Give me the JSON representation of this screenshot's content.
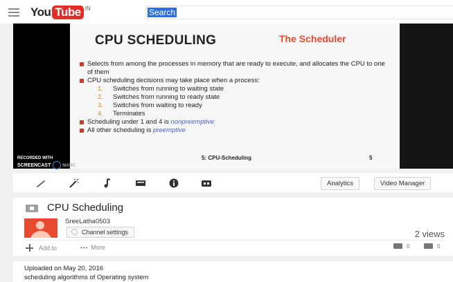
{
  "header": {
    "logo_you": "You",
    "logo_tube": "Tube",
    "logo_region": "IN",
    "search_value": "Search"
  },
  "video": {
    "slide": {
      "title": "CPU SCHEDULING",
      "subtitle": "The Scheduler",
      "bullet1": "Selects from among the processes in memory that are ready to execute, and allocates the CPU to one of them",
      "bullet2": "CPU scheduling decisions may take place when a process:",
      "items": [
        {
          "num": "1.",
          "text": "Switches from running to waiting state"
        },
        {
          "num": "2.",
          "text": "Switches from running to ready state"
        },
        {
          "num": "3.",
          "text": "Switches from waiting to ready"
        },
        {
          "num": "4.",
          "text": "Terminates"
        }
      ],
      "bullet3_prefix": "Scheduling under 1 and 4 is ",
      "bullet3_italic": "nonpreemptive",
      "bullet4_prefix": "All other scheduling is ",
      "bullet4_italic": "preemptive",
      "footer": "5: CPU-Scheduling",
      "page": "5"
    },
    "watermark": {
      "line1": "RECORDED WITH",
      "line2": "SCREENCAST",
      "line3": "MATIC"
    }
  },
  "controls": {
    "icons": [
      "pen-icon",
      "magic-wand-icon",
      "music-note-icon",
      "annotation-icon",
      "info-icon",
      "captions-icon"
    ],
    "analytics_label": "Analytics",
    "video_manager_label": "Video Manager"
  },
  "info": {
    "title": "CPU Scheduling",
    "channel_name": "SreeLatha0503",
    "channel_settings_label": "Channel settings",
    "views": "2 views",
    "add_to_label": "Add to",
    "more_label": "More",
    "likes": "0",
    "dislikes": "0"
  },
  "description": {
    "uploaded": "Uploaded on May 20, 2016",
    "text": "scheduling algorithms of Operating system"
  },
  "colors": {
    "brand_red": "#e52d27",
    "slide_accent": "#e8472a",
    "search_selection": "#2f6fd9"
  }
}
